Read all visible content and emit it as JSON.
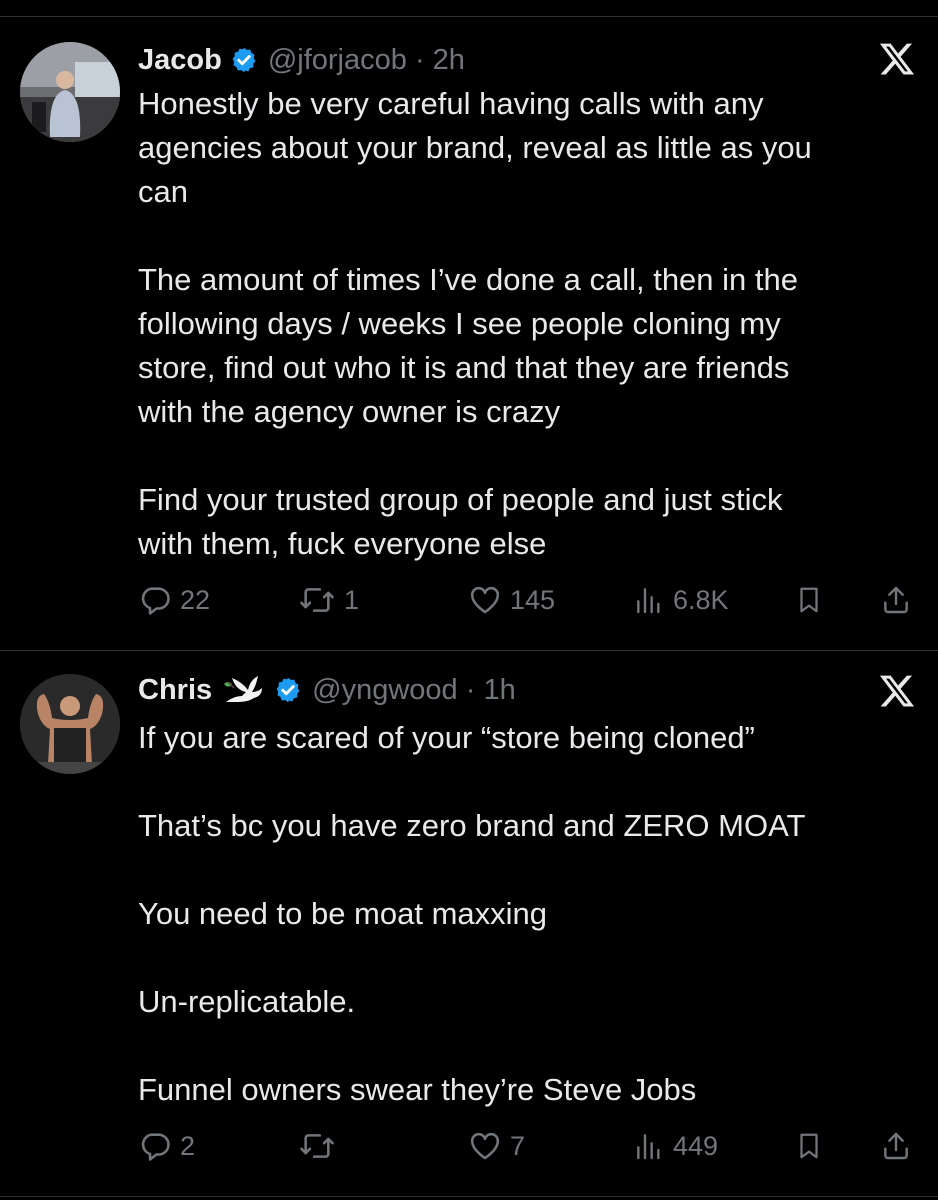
{
  "tweets": [
    {
      "name": "Jacob",
      "emoji": "",
      "handle": "@jforjacob",
      "time": "· 2h",
      "lines": [
        "Honestly be very careful having calls with any",
        "agencies about your brand, reveal as little as you",
        "can",
        "",
        "The amount of times I’ve done a call, then in the",
        "following days / weeks I see people cloning my",
        "store, find out who it is and that they are friends",
        "with the agency owner is crazy",
        "",
        "Find your trusted group of people and just stick",
        "with them, fuck everyone else"
      ],
      "replies": "22",
      "reposts": "1",
      "likes": "145",
      "views": "6.8K"
    },
    {
      "name": "Chris",
      "emoji": "dove-emoji",
      "handle": "@yngwood",
      "time": "· 1h",
      "lines": [
        "If you are scared of your “store being cloned”",
        "",
        "That’s bc you have zero brand and ZERO MOAT",
        "",
        "You need to be moat maxxing",
        "",
        "Un-replicatable.",
        "",
        "Funnel owners swear they’re Steve Jobs"
      ],
      "replies": "2",
      "reposts": "",
      "likes": "7",
      "views": "449"
    }
  ],
  "colors": {
    "background": "#000000",
    "text": "#e7e9ea",
    "muted": "#71767b",
    "verified": "#1d9bf0",
    "divider": "#2f3336"
  }
}
